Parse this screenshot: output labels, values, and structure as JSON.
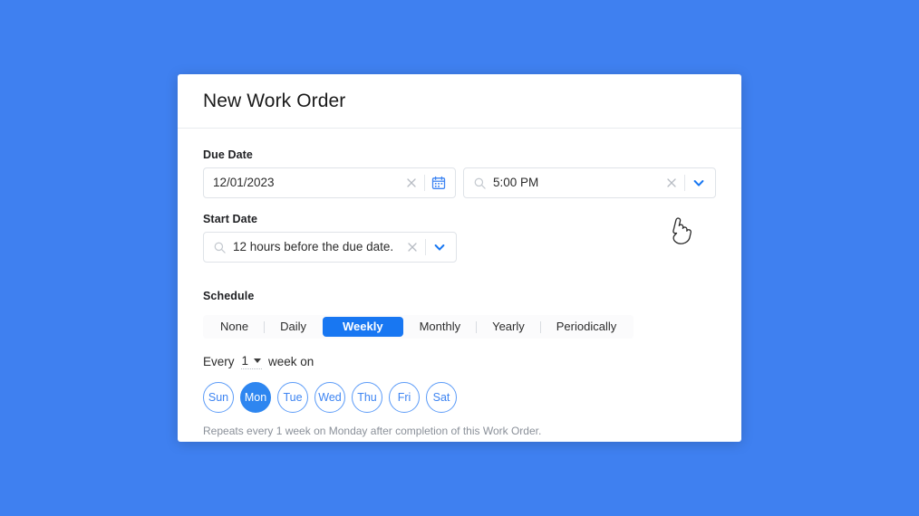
{
  "window": {
    "background_color": "#3f80f0"
  },
  "header": {
    "title": "New Work Order"
  },
  "due_date": {
    "label": "Due Date",
    "date_field": {
      "value": "12/01/2023",
      "clear_icon": "close-x-icon",
      "calendar_icon": "calendar-icon"
    },
    "time_field": {
      "search_icon": "search-icon",
      "value": "5:00 PM",
      "clear_icon": "close-x-icon",
      "dropdown_icon": "chevron-down-icon"
    }
  },
  "start_date": {
    "label": "Start Date",
    "field": {
      "search_icon": "search-icon",
      "value": "12 hours before the due date.",
      "clear_icon": "close-x-icon",
      "dropdown_icon": "chevron-down-icon"
    }
  },
  "schedule": {
    "label": "Schedule",
    "tabs": [
      {
        "label": "None",
        "selected": false
      },
      {
        "label": "Daily",
        "selected": false
      },
      {
        "label": "Weekly",
        "selected": true
      },
      {
        "label": "Monthly",
        "selected": false
      },
      {
        "label": "Yearly",
        "selected": false
      },
      {
        "label": "Periodically",
        "selected": false
      }
    ],
    "selected_tab": "Weekly",
    "accent_color": "#1877f2"
  },
  "recurrence": {
    "prefix_label": "Every",
    "interval_value": "1",
    "suffix_label": "week on",
    "days": [
      {
        "label": "Sun",
        "selected": false
      },
      {
        "label": "Mon",
        "selected": true
      },
      {
        "label": "Tue",
        "selected": false
      },
      {
        "label": "Wed",
        "selected": false
      },
      {
        "label": "Thu",
        "selected": false
      },
      {
        "label": "Fri",
        "selected": false
      },
      {
        "label": "Sat",
        "selected": false
      }
    ],
    "note": "Repeats every 1 week on Monday after completion of this Work Order."
  },
  "cursor": {
    "icon": "pointing-hand-cursor"
  }
}
